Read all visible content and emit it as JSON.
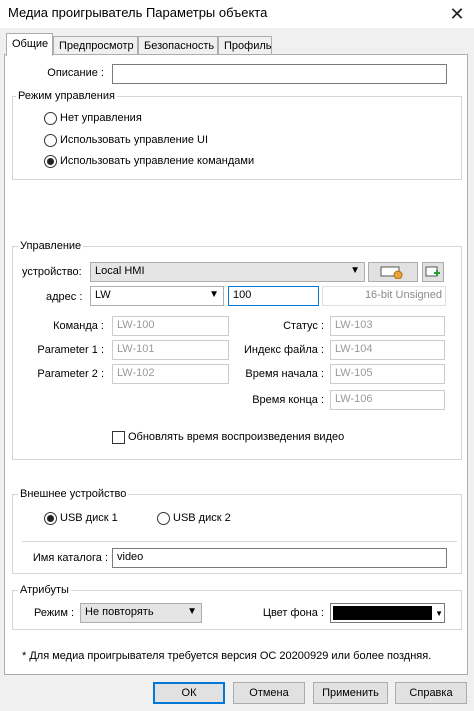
{
  "window": {
    "title": "Медиа проигрыватель Параметры объекта",
    "close_glyph": "✕"
  },
  "tabs": [
    {
      "label": "Общие",
      "active": true
    },
    {
      "label": "Предпросмотр",
      "active": false
    },
    {
      "label": "Безопасность",
      "active": false
    },
    {
      "label": "Профиль",
      "active": false
    }
  ],
  "description": {
    "label": "Описание :",
    "value": ""
  },
  "control_mode": {
    "title": "Режим управления",
    "options": [
      {
        "label": "Нет управления",
        "checked": false
      },
      {
        "label": "Использовать управление UI",
        "checked": false
      },
      {
        "label": "Использовать управление командами",
        "checked": true
      }
    ]
  },
  "control": {
    "title": "Управление",
    "device_label": "устройство:",
    "device_value": "Local HMI",
    "address_label": "адрес :",
    "address_type": "LW",
    "address_value": "100",
    "address_format": "16-bit Unsigned",
    "left_fields": [
      {
        "label": "Команда :",
        "value": "LW-100"
      },
      {
        "label": "Parameter 1 :",
        "value": "LW-101"
      },
      {
        "label": "Parameter 2 :",
        "value": "LW-102"
      }
    ],
    "right_fields": [
      {
        "label": "Статус :",
        "value": "LW-103"
      },
      {
        "label": "Индекс файла :",
        "value": "LW-104"
      },
      {
        "label": "Время начала :",
        "value": "LW-105"
      },
      {
        "label": "Время конца :",
        "value": "LW-106"
      }
    ],
    "refresh_checkbox": {
      "label": "Обновлять время воспроизведения видео",
      "checked": false
    }
  },
  "external_device": {
    "title": "Внешнее устройство",
    "options": [
      {
        "label": "USB диск 1",
        "checked": true
      },
      {
        "label": "USB диск 2",
        "checked": false
      }
    ],
    "folder_label": "Имя каталога :",
    "folder_value": "video"
  },
  "attributes": {
    "title": "Атрибуты",
    "mode_label": "Режим :",
    "mode_value": "Не повторять",
    "bg_label": "Цвет фона :",
    "bg_color": "#000000"
  },
  "note": "* Для медиа проигрывателя требуется версия ОС 20200929 или более поздняя.",
  "buttons": {
    "ok": "ОК",
    "cancel": "Отмена",
    "apply": "Применить",
    "help": "Справка"
  }
}
